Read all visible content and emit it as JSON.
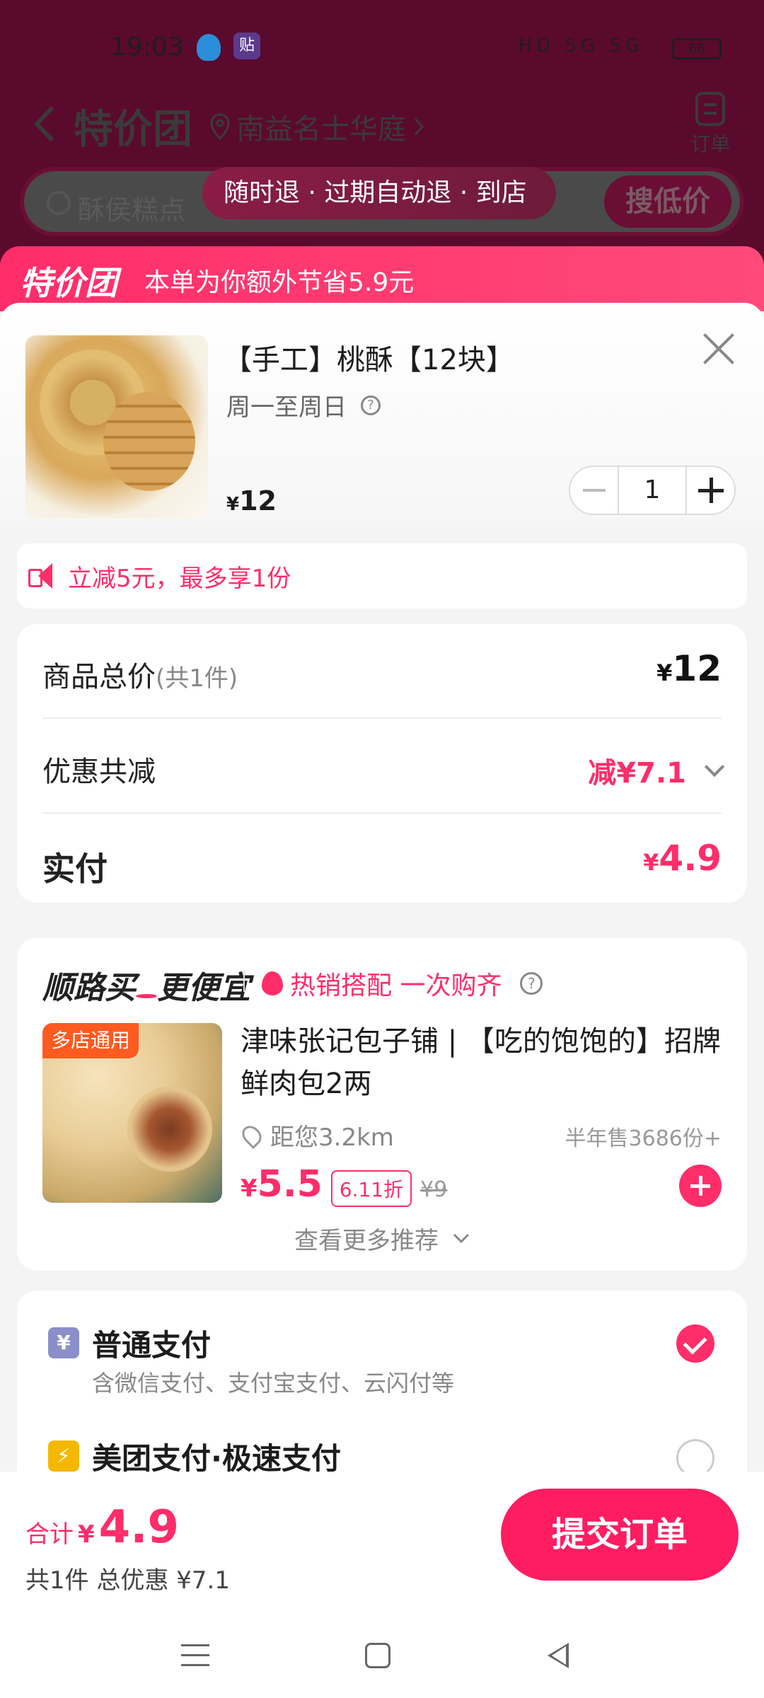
{
  "status_bar": {
    "time": "19:03",
    "app_badge": "贴",
    "signal": "HD 5G 5G",
    "battery": "66"
  },
  "header": {
    "title": "特价团",
    "location": "南益名士华庭",
    "order_label": "订单"
  },
  "search": {
    "placeholder": "酥侯糕点",
    "button": "搜低价",
    "tip": "随时退 · 过期自动退 · 到店"
  },
  "banner": {
    "brand": "特价团",
    "note": "本单为你额外节省5.9元"
  },
  "product": {
    "name": "【手工】桃酥【12块】",
    "schedule": "周一至周日",
    "price_symbol": "¥",
    "price": "12",
    "quantity": "1"
  },
  "promo": {
    "text": "立减5元，最多享1份"
  },
  "summary": {
    "total_label": "商品总价",
    "total_count": "(共1件)",
    "total_symbol": "¥",
    "total_value": "12",
    "discount_label": "优惠共减",
    "discount_value": "减¥7.1",
    "pay_label": "实付",
    "pay_symbol": "¥",
    "pay_value": "4.9"
  },
  "recommend": {
    "title_part1": "顺路买",
    "title_part2": "更便宜",
    "hot": "热销搭配 一次购齐",
    "badge": "多店通用",
    "name": "津味张记包子铺 | 【吃的饱饱的】招牌鲜肉包2两",
    "distance": "距您3.2km",
    "sold": "半年售3686份+",
    "price_symbol": "¥",
    "price": "5.5",
    "discount": "6.11折",
    "original": "¥9",
    "more": "查看更多推荐"
  },
  "payment": {
    "methods": [
      {
        "icon": "¥",
        "name": "普通支付",
        "sub": "含微信支付、支付宝支付、云闪付等",
        "selected": true
      },
      {
        "icon": "⚡",
        "name": "美团支付·极速支付",
        "sub": "",
        "selected": false
      }
    ]
  },
  "footer": {
    "total_label": "合计",
    "total_symbol": "¥",
    "total_value": "4.9",
    "summary": "共1件  总优惠 ¥7.1",
    "submit": "提交订单"
  },
  "colors": {
    "accent": "#ff2d6a",
    "header_bg": "#5a0a2c"
  }
}
